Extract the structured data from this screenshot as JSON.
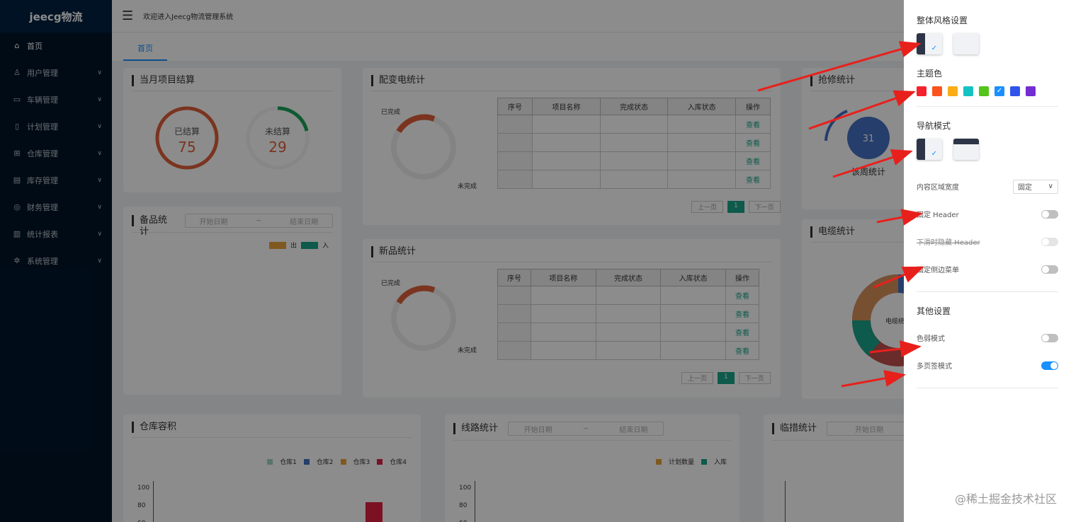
{
  "app": {
    "logo": "jeecg物流",
    "welcome": "欢迎进入Jeecg物流管理系统"
  },
  "sidebar": {
    "items": [
      {
        "label": "首页",
        "icon": "home-icon"
      },
      {
        "label": "用户管理",
        "icon": "user-icon"
      },
      {
        "label": "车辆管理",
        "icon": "car-icon"
      },
      {
        "label": "计划管理",
        "icon": "file-icon"
      },
      {
        "label": "仓库管理",
        "icon": "warehouse-icon"
      },
      {
        "label": "库存管理",
        "icon": "inventory-icon"
      },
      {
        "label": "财务管理",
        "icon": "money-icon"
      },
      {
        "label": "统计报表",
        "icon": "chart-icon"
      },
      {
        "label": "系统管理",
        "icon": "gear-icon"
      }
    ]
  },
  "tabs": [
    {
      "label": "首页"
    }
  ],
  "cards": {
    "settlement": {
      "title": "当月项目结算",
      "done_label": "已结算",
      "done_value": "75",
      "undone_label": "未结算",
      "undone_value": "29"
    },
    "power": {
      "title": "配变电统计",
      "done": "已完成",
      "undone": "未完成"
    },
    "repair": {
      "title": "抢修统计",
      "value": "31",
      "label": "该周统计"
    },
    "spare": {
      "title": "备品统计",
      "start": "开始日期",
      "sep": "~",
      "end": "结束日期",
      "legend_out": "出",
      "legend_in": "入"
    },
    "newgoods": {
      "title": "新品统计",
      "done": "已完成",
      "undone": "未完成"
    },
    "cable": {
      "title": "电缆统计",
      "center": "电缆统计"
    },
    "capacity": {
      "title": "仓库容积",
      "legend": [
        "仓库1",
        "仓库2",
        "仓库3",
        "仓库4"
      ],
      "ticks": [
        "100",
        "80",
        "60"
      ]
    },
    "line": {
      "title": "线路统计",
      "start": "开始日期",
      "sep": "~",
      "end": "结束日期",
      "legend": [
        "计划数量",
        "入库"
      ],
      "ticks": [
        "100",
        "80",
        "60"
      ]
    },
    "temp": {
      "title": "临措统计",
      "start": "开始日期"
    }
  },
  "table": {
    "headers": [
      "序号",
      "项目名称",
      "完成状态",
      "入库状态",
      "操作"
    ],
    "action": "查看",
    "pager": {
      "prev": "上一页",
      "page": "1",
      "next": "下一页"
    }
  },
  "drawer": {
    "overall_style": "整体风格设置",
    "theme_color": "主题色",
    "nav_mode": "导航模式",
    "content_width": "内容区域宽度",
    "content_width_value": "固定",
    "fixed_header": "固定 Header",
    "hide_header": "下滑时隐藏 Header",
    "fixed_sidebar": "固定侧边菜单",
    "other": "其他设置",
    "weak_mode": "色弱模式",
    "multi_tab": "多页签模式",
    "check": "✓",
    "colors": [
      "#f5222d",
      "#fa541c",
      "#faad14",
      "#13c2c2",
      "#52c41a",
      "#1890ff",
      "#2f54eb",
      "#722ed1"
    ]
  },
  "watermark": "@稀土掘金技术社区"
}
